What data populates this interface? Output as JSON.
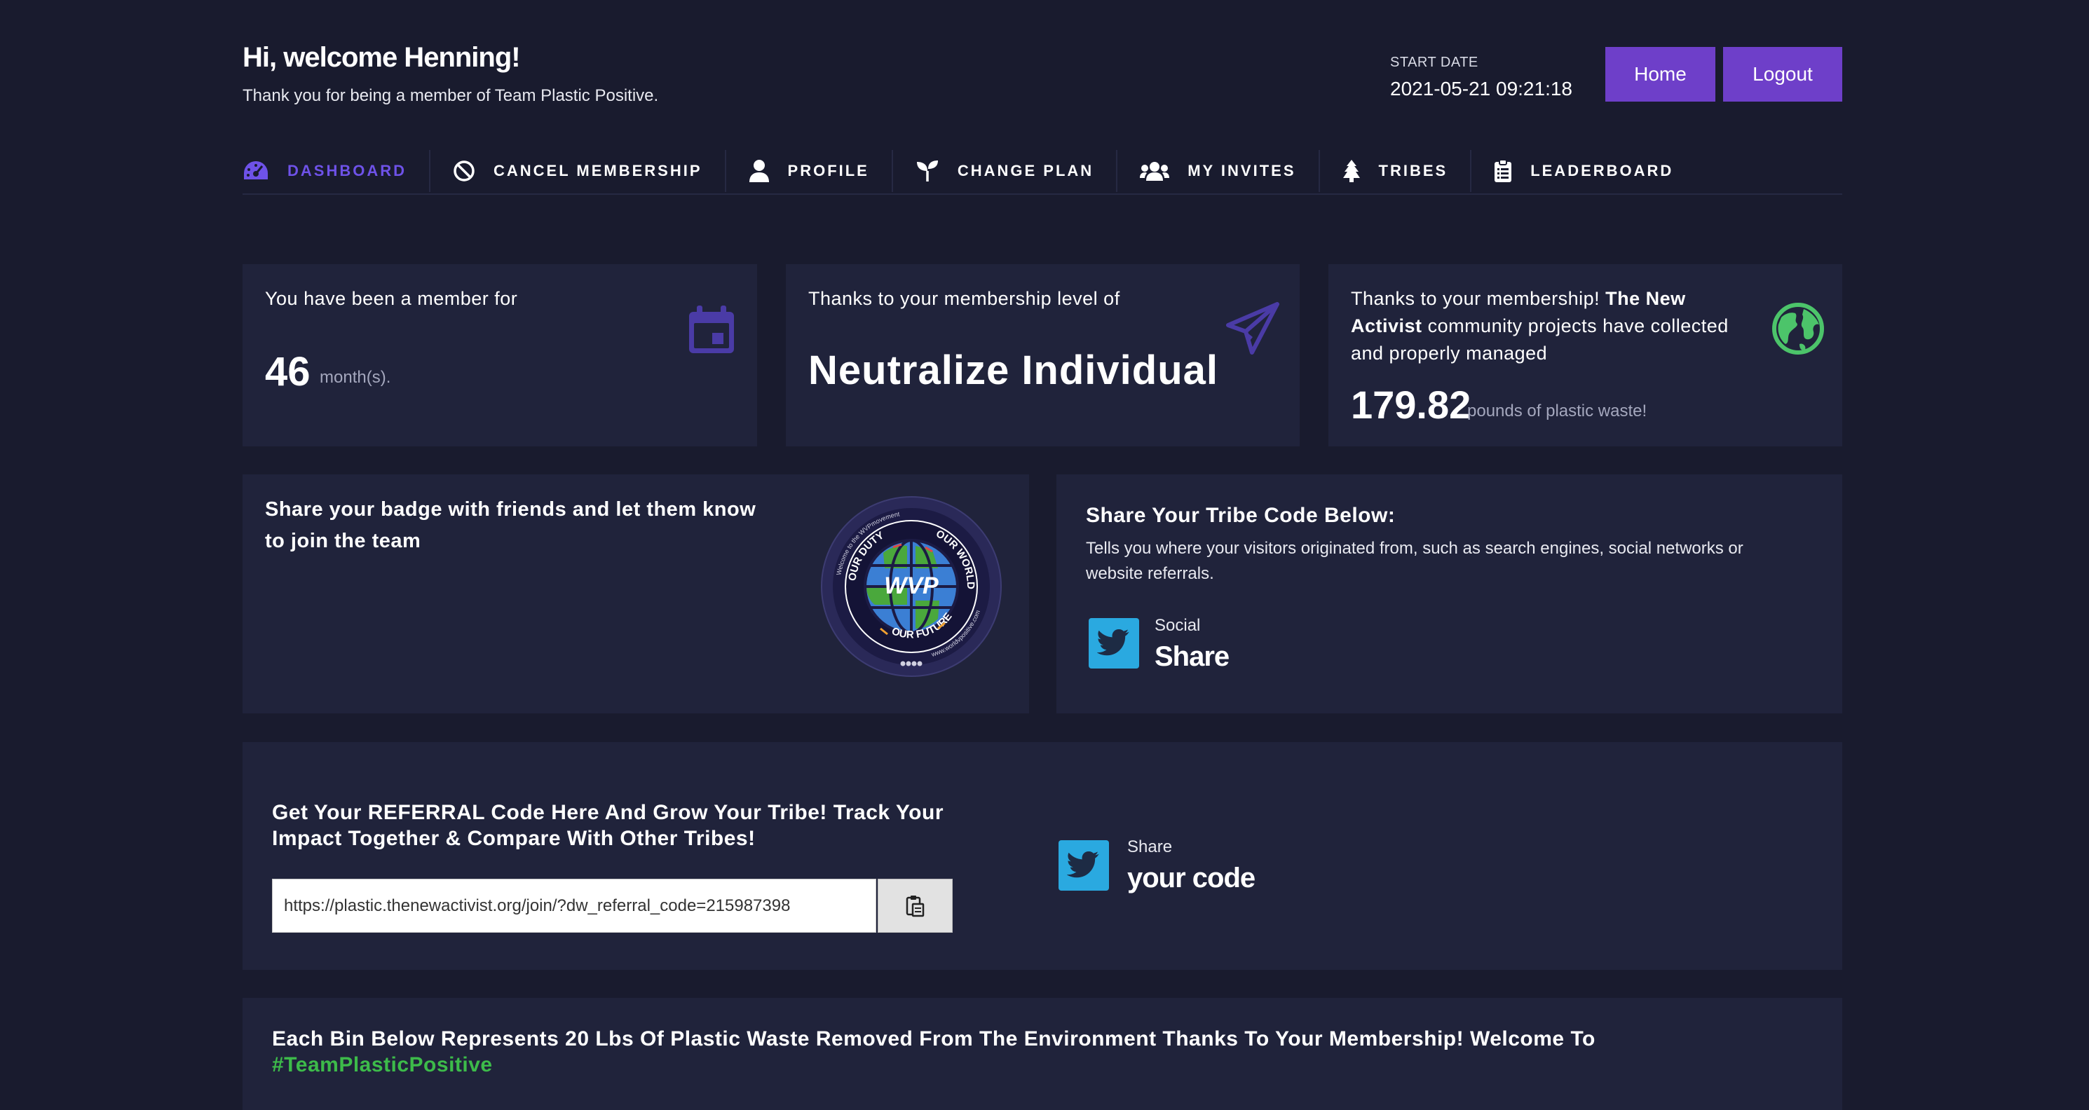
{
  "header": {
    "greeting": "Hi, welcome Henning!",
    "subtitle": "Thank you for being a member of Team Plastic Positive.",
    "start_date_label": "START DATE",
    "start_date_value": "2021-05-21 09:21:18",
    "home_label": "Home",
    "logout_label": "Logout"
  },
  "nav": {
    "items": [
      {
        "label": "DASHBOARD",
        "icon": "gauge-icon",
        "active": true
      },
      {
        "label": "CANCEL MEMBERSHIP",
        "icon": "ban-icon"
      },
      {
        "label": "PROFILE",
        "icon": "user-icon"
      },
      {
        "label": "CHANGE PLAN",
        "icon": "seedling-icon"
      },
      {
        "label": "MY INVITES",
        "icon": "users-icon"
      },
      {
        "label": "TRIBES",
        "icon": "tree-icon"
      },
      {
        "label": "LEADERBOARD",
        "icon": "clipboard-list-icon"
      }
    ]
  },
  "cards": {
    "member_for": {
      "intro": "You have been a member for",
      "value": "46",
      "unit": "month(s).",
      "icon": "calendar-icon"
    },
    "level": {
      "intro": "Thanks to your membership level of",
      "value": "Neutralize Individual",
      "icon": "paper-plane-icon"
    },
    "collected": {
      "intro_prefix": "Thanks to your membership!",
      "intro_bold": "The New Activist",
      "intro_suffix": "community projects have collected and properly managed",
      "value": "179.82",
      "unit": "pounds of plastic waste!",
      "icon": "globe-icon"
    }
  },
  "badge": {
    "text": "Share your badge with friends and let them know to join the team",
    "badge_center": "WVP",
    "badge_top": "Welcome to the WVPmovement",
    "badge_our_world": "OUR WORLD",
    "badge_our_duty": "OUR DUTY",
    "badge_our_future": "OUR FUTURE",
    "badge_site": "www.worldvpositive.com"
  },
  "tribe_code": {
    "title": "Share Your Tribe Code Below:",
    "description": "Tells you where your visitors originated from, such as search engines, social networks or website referrals.",
    "share_small": "Social",
    "share_big": "Share"
  },
  "referral": {
    "title": "Get Your REFERRAL Code Here And Grow Your Tribe! Track Your Impact Together & Compare With Other Tribes!",
    "url": "https://plastic.thenewactivist.org/join/?dw_referral_code=215987398",
    "share_small": "Share",
    "share_big": "your code"
  },
  "bins": {
    "prefix": "Each Bin Below Represents",
    "amount": "20 Lbs",
    "middle": "Of Plastic Waste Removed From The Environment Thanks To Your Membership! Welcome To",
    "hashtag": "#TeamPlasticPositive"
  },
  "colors": {
    "background": "#191b2e",
    "card": "#20233b",
    "accent": "#6e3fc9",
    "active_nav": "#6e52e8",
    "twitter": "#2aa9e0",
    "hashtag_green": "#3dbb4a"
  }
}
